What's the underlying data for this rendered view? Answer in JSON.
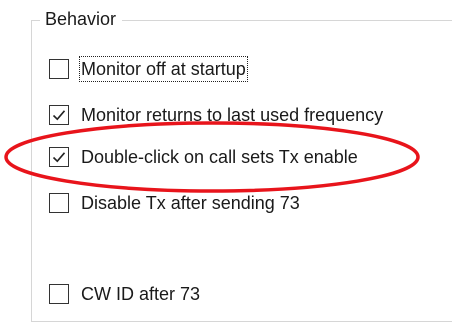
{
  "group": {
    "title": "Behavior"
  },
  "options": [
    {
      "label": "Monitor off at startup",
      "checked": false,
      "focused": true
    },
    {
      "label": "Monitor returns to last used frequency",
      "checked": true,
      "focused": false
    },
    {
      "label": "Double-click on call sets Tx enable",
      "checked": true,
      "focused": false
    },
    {
      "label": "Disable Tx after sending 73",
      "checked": false,
      "focused": false
    },
    {
      "label": "CW ID after 73",
      "checked": false,
      "focused": false
    }
  ],
  "annotation": {
    "color": "#e8141b"
  }
}
